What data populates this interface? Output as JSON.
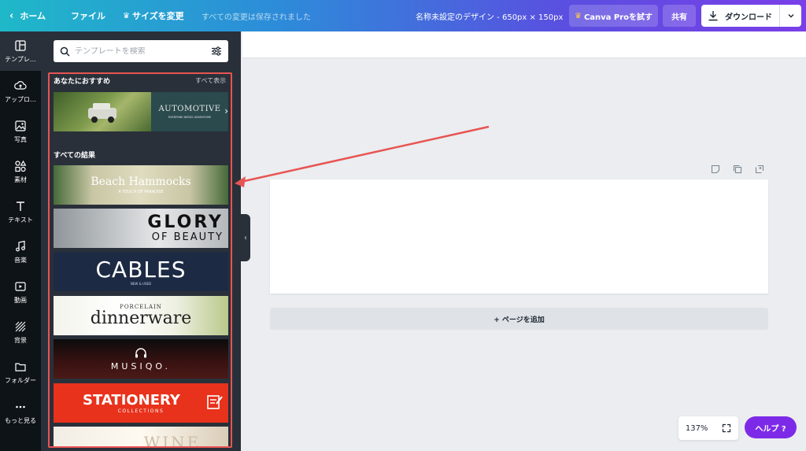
{
  "topbar": {
    "home_label": "ホーム",
    "file_label": "ファイル",
    "resize_label": "サイズを変更",
    "saved_status": "すべての変更は保存されました",
    "design_title": "名称未設定のデザイン - 650px × 150px",
    "pro_label": "Canva Proを試す",
    "share_label": "共有",
    "download_label": "ダウンロード"
  },
  "rail": {
    "items": [
      {
        "label": "テンプレ…",
        "icon": "template-icon"
      },
      {
        "label": "アップロ…",
        "icon": "upload-icon"
      },
      {
        "label": "写真",
        "icon": "photo-icon"
      },
      {
        "label": "素材",
        "icon": "elements-icon"
      },
      {
        "label": "テキスト",
        "icon": "text-icon"
      },
      {
        "label": "音楽",
        "icon": "music-icon"
      },
      {
        "label": "動画",
        "icon": "video-icon"
      },
      {
        "label": "背景",
        "icon": "background-icon"
      },
      {
        "label": "フォルダー",
        "icon": "folder-icon"
      },
      {
        "label": "もっと見る",
        "icon": "more-icon"
      }
    ]
  },
  "panel": {
    "search_placeholder": "テンプレートを検索",
    "recommended_title": "あなたにおすすめ",
    "see_all": "すべて表示",
    "all_results_title": "すべての結果",
    "featured": {
      "title": "AUTOMOTIVE",
      "subtitle": "EVERYONE NEEDS ADVENTURE"
    },
    "templates": [
      {
        "title": "Beach Hammocks",
        "subtitle": "A TOUCH OF PARADISE"
      },
      {
        "title": "GLORY",
        "subtitle": "OF BEAUTY"
      },
      {
        "title": "CABLES",
        "subtitle": "NEW & USED"
      },
      {
        "title": "dinnerware",
        "subtitle": "PORCELAIN"
      },
      {
        "title": "MUSIQO.",
        "subtitle": ""
      },
      {
        "title": "STATIONERY",
        "subtitle": "COLLECTIONS"
      },
      {
        "title": "WINE",
        "subtitle": ""
      }
    ]
  },
  "canvas": {
    "add_page_label": "+ ページを追加",
    "zoom": "137%",
    "help_label": "ヘルプ ?"
  },
  "colors": {
    "accent": "#7d2ae8",
    "annotation": "#e85453",
    "panel_bg": "#293039",
    "rail_bg": "#0e1318"
  }
}
